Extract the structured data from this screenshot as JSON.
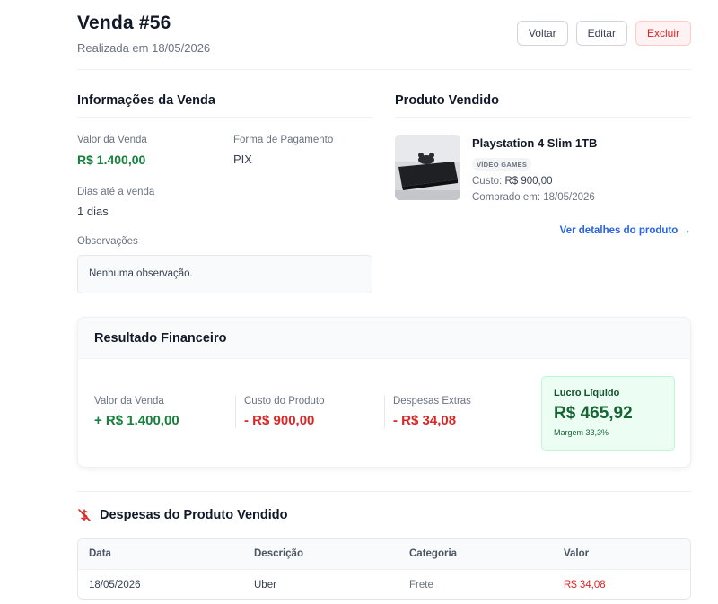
{
  "header": {
    "title": "Venda #56",
    "subtitle": "Realizada em 18/05/2026",
    "back_label": "Voltar",
    "edit_label": "Editar",
    "delete_label": "Excluir"
  },
  "sale_info": {
    "section_title": "Informações da Venda",
    "sale_value_label": "Valor da Venda",
    "sale_value": "R$ 1.400,00",
    "payment_label": "Forma de Pagamento",
    "payment_value": "PIX",
    "days_label": "Dias até a venda",
    "days_value": "1 dias",
    "notes_label": "Observações",
    "notes_value": "Nenhuma observação."
  },
  "product": {
    "section_title": "Produto Vendido",
    "name": "Playstation 4 Slim 1TB",
    "category_badge": "VÍDEO GAMES",
    "cost_label": "Custo:",
    "cost_value": "R$ 900,00",
    "purchased": "Comprado em: 18/05/2026",
    "details_link": "Ver detalhes do produto →"
  },
  "financial": {
    "title": "Resultado Financeiro",
    "sale_label": "Valor da Venda",
    "sale_value": "+ R$ 1.400,00",
    "cost_label": "Custo do Produto",
    "cost_value": "- R$ 900,00",
    "extra_label": "Despesas Extras",
    "extra_value": "- R$ 34,08",
    "profit_label": "Lucro Líquido",
    "profit_value": "R$ 465,92",
    "margin": "Margem 33,3%"
  },
  "expenses": {
    "title": "Despesas do Produto Vendido",
    "columns": [
      "Data",
      "Descrição",
      "Categoria",
      "Valor"
    ],
    "rows": [
      {
        "date": "18/05/2026",
        "description": "Uber",
        "category": "Frete",
        "value": "R$ 34,08"
      }
    ]
  },
  "colors": {
    "green": "#16803c",
    "red": "#dc2626",
    "link": "#2563eb"
  }
}
